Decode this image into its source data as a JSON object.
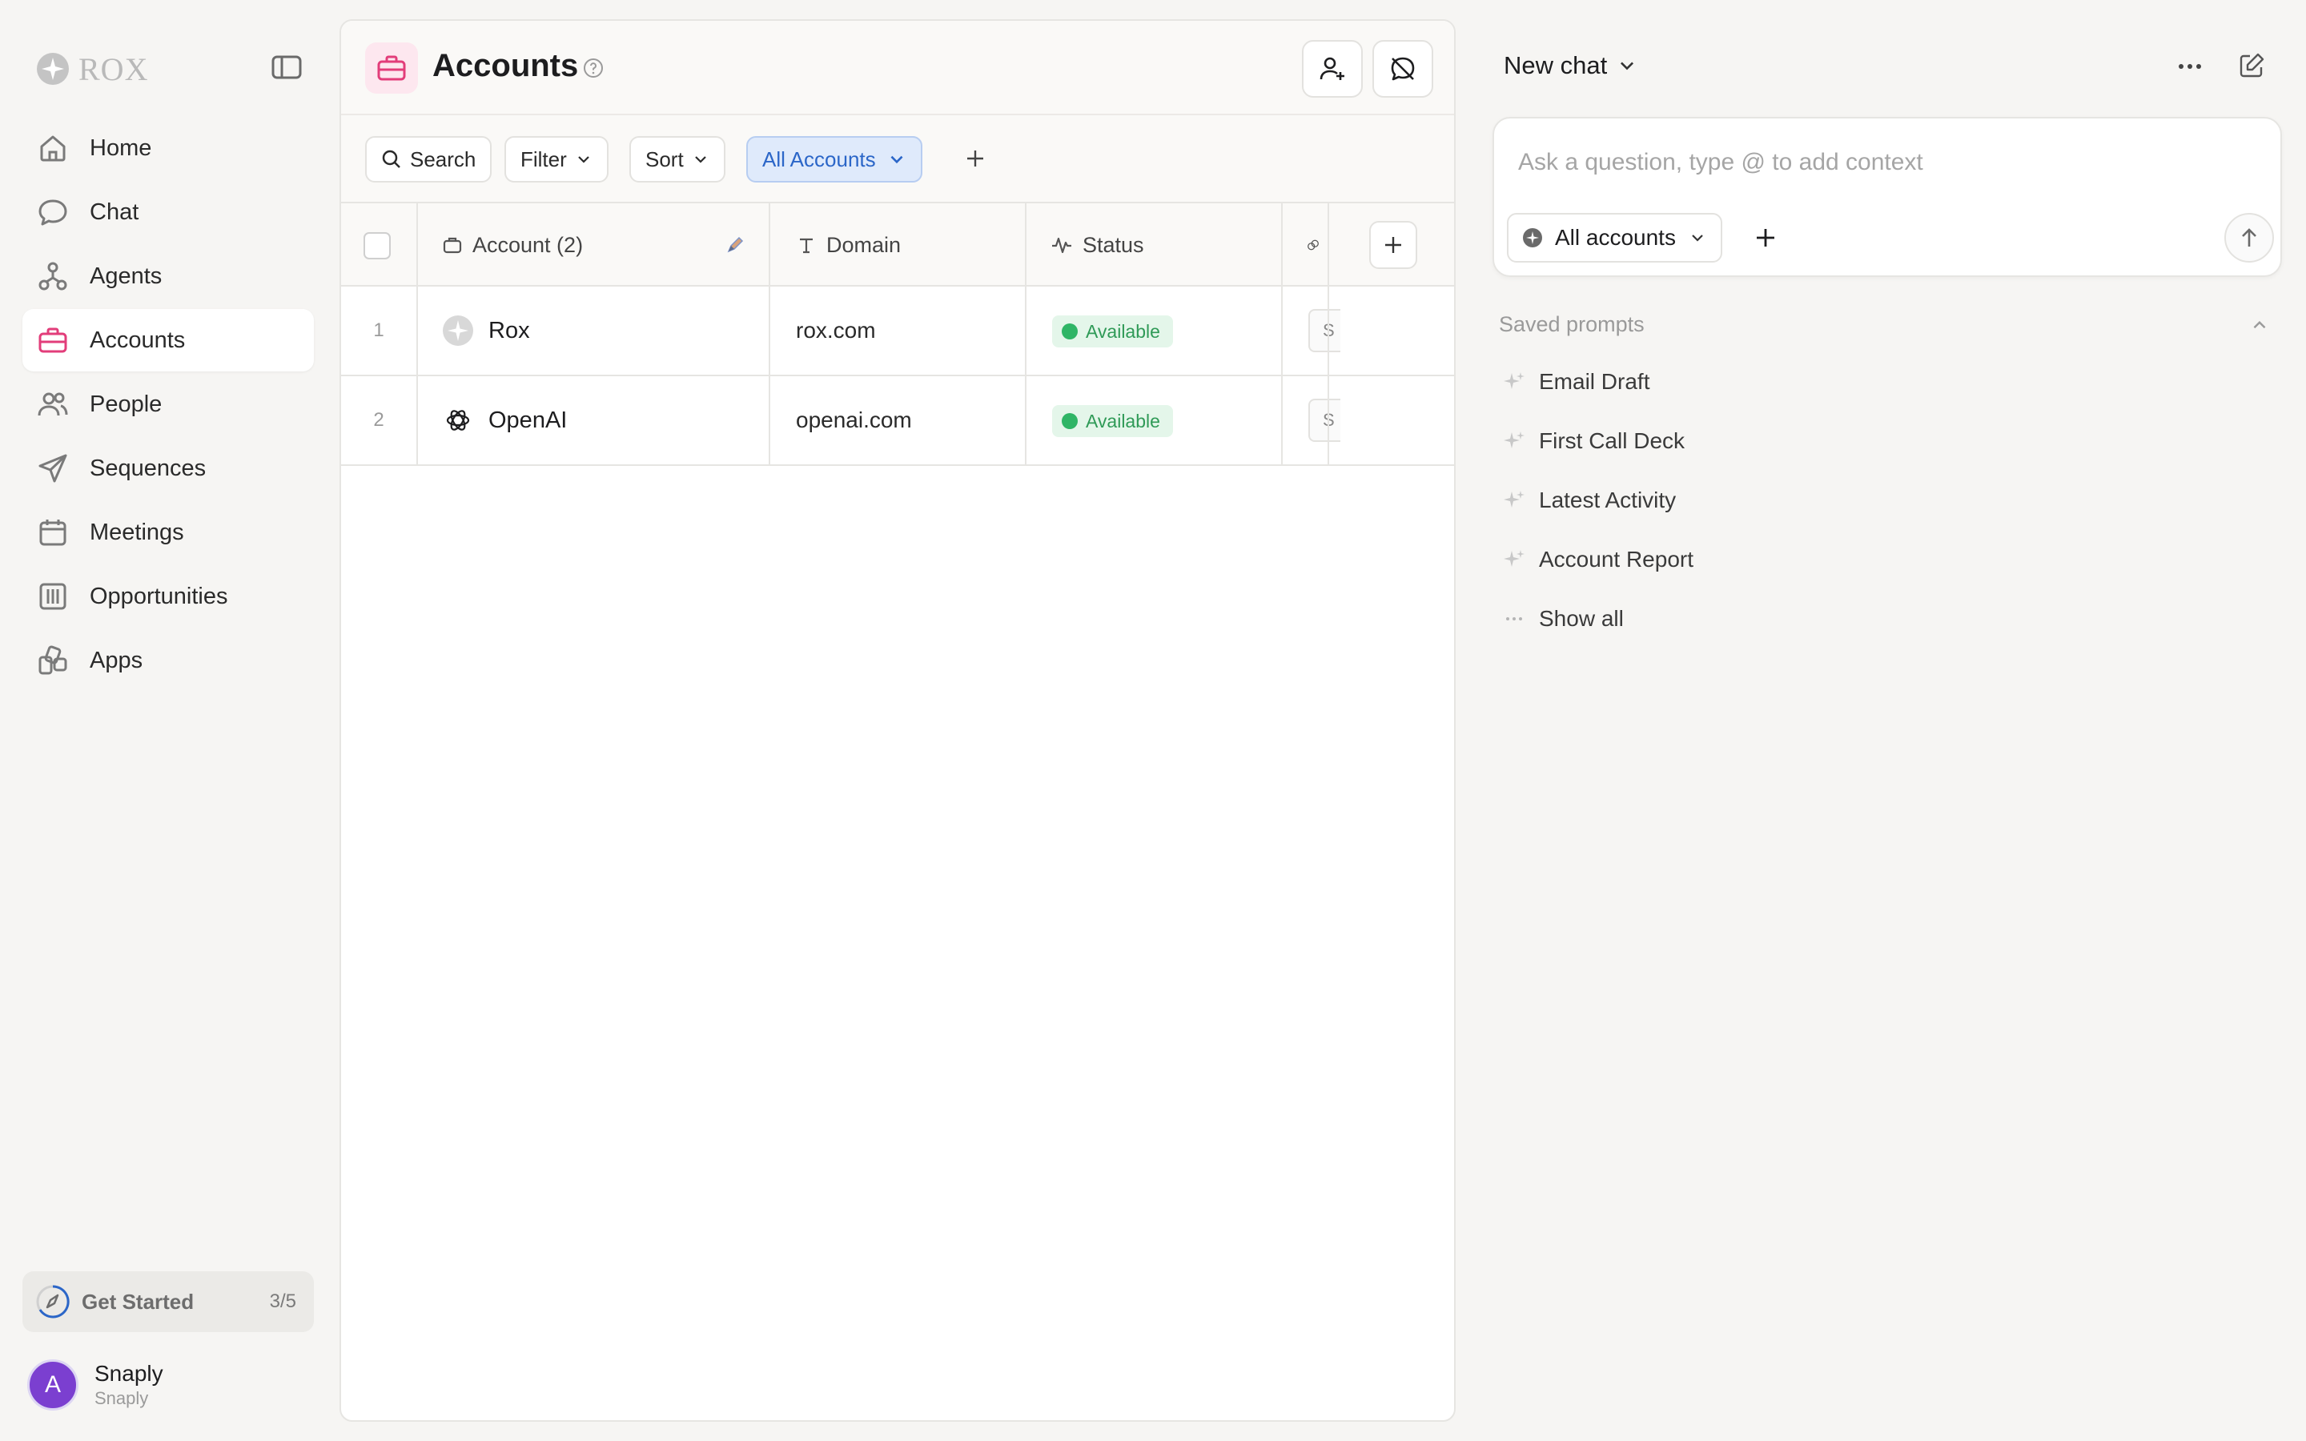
{
  "brand": {
    "name": "ROX"
  },
  "sidebar": {
    "items": [
      {
        "label": "Home",
        "icon": "home-icon"
      },
      {
        "label": "Chat",
        "icon": "chat-bubble-icon"
      },
      {
        "label": "Agents",
        "icon": "agents-icon"
      },
      {
        "label": "Accounts",
        "icon": "briefcase-icon",
        "active": true
      },
      {
        "label": "People",
        "icon": "people-icon"
      },
      {
        "label": "Sequences",
        "icon": "send-icon"
      },
      {
        "label": "Meetings",
        "icon": "calendar-icon"
      },
      {
        "label": "Opportunities",
        "icon": "columns-icon"
      },
      {
        "label": "Apps",
        "icon": "apps-icon"
      }
    ],
    "get_started": {
      "label": "Get Started",
      "progress": "3/5"
    },
    "user": {
      "initial": "A",
      "name": "Snaply",
      "org": "Snaply"
    }
  },
  "main": {
    "title": "Accounts",
    "toolbar": {
      "search": "Search",
      "filter": "Filter",
      "sort": "Sort",
      "view": "All Accounts"
    },
    "table": {
      "columns": {
        "account": "Account (2)",
        "domain": "Domain",
        "status": "Status"
      },
      "rows": [
        {
          "num": "1",
          "account": "Rox",
          "domain": "rox.com",
          "status": "Available",
          "extra": "S"
        },
        {
          "num": "2",
          "account": "OpenAI",
          "domain": "openai.com",
          "status": "Available",
          "extra": "S"
        }
      ]
    }
  },
  "chat": {
    "title": "New chat",
    "placeholder": "Ask a question, type @ to add context",
    "context": "All accounts",
    "saved_prompts_title": "Saved prompts",
    "saved_prompts": [
      "Email Draft",
      "First Call Deck",
      "Latest Activity",
      "Account Report"
    ],
    "show_all": "Show all"
  },
  "colors": {
    "accent_pink": "#e23d7a",
    "view_blue": "#2b66c8",
    "status_green": "#2fb566",
    "avatar_purple": "#7b3fd0"
  }
}
